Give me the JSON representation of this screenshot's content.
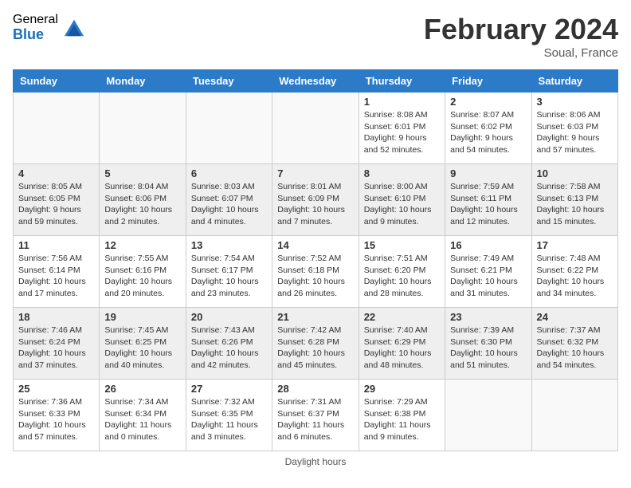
{
  "header": {
    "logo_general": "General",
    "logo_blue": "Blue",
    "month_title": "February 2024",
    "location": "Soual, France"
  },
  "weekdays": [
    "Sunday",
    "Monday",
    "Tuesday",
    "Wednesday",
    "Thursday",
    "Friday",
    "Saturday"
  ],
  "weeks": [
    [
      {
        "day": "",
        "info": ""
      },
      {
        "day": "",
        "info": ""
      },
      {
        "day": "",
        "info": ""
      },
      {
        "day": "",
        "info": ""
      },
      {
        "day": "1",
        "info": "Sunrise: 8:08 AM\nSunset: 6:01 PM\nDaylight: 9 hours and 52 minutes."
      },
      {
        "day": "2",
        "info": "Sunrise: 8:07 AM\nSunset: 6:02 PM\nDaylight: 9 hours and 54 minutes."
      },
      {
        "day": "3",
        "info": "Sunrise: 8:06 AM\nSunset: 6:03 PM\nDaylight: 9 hours and 57 minutes."
      }
    ],
    [
      {
        "day": "4",
        "info": "Sunrise: 8:05 AM\nSunset: 6:05 PM\nDaylight: 9 hours and 59 minutes."
      },
      {
        "day": "5",
        "info": "Sunrise: 8:04 AM\nSunset: 6:06 PM\nDaylight: 10 hours and 2 minutes."
      },
      {
        "day": "6",
        "info": "Sunrise: 8:03 AM\nSunset: 6:07 PM\nDaylight: 10 hours and 4 minutes."
      },
      {
        "day": "7",
        "info": "Sunrise: 8:01 AM\nSunset: 6:09 PM\nDaylight: 10 hours and 7 minutes."
      },
      {
        "day": "8",
        "info": "Sunrise: 8:00 AM\nSunset: 6:10 PM\nDaylight: 10 hours and 9 minutes."
      },
      {
        "day": "9",
        "info": "Sunrise: 7:59 AM\nSunset: 6:11 PM\nDaylight: 10 hours and 12 minutes."
      },
      {
        "day": "10",
        "info": "Sunrise: 7:58 AM\nSunset: 6:13 PM\nDaylight: 10 hours and 15 minutes."
      }
    ],
    [
      {
        "day": "11",
        "info": "Sunrise: 7:56 AM\nSunset: 6:14 PM\nDaylight: 10 hours and 17 minutes."
      },
      {
        "day": "12",
        "info": "Sunrise: 7:55 AM\nSunset: 6:16 PM\nDaylight: 10 hours and 20 minutes."
      },
      {
        "day": "13",
        "info": "Sunrise: 7:54 AM\nSunset: 6:17 PM\nDaylight: 10 hours and 23 minutes."
      },
      {
        "day": "14",
        "info": "Sunrise: 7:52 AM\nSunset: 6:18 PM\nDaylight: 10 hours and 26 minutes."
      },
      {
        "day": "15",
        "info": "Sunrise: 7:51 AM\nSunset: 6:20 PM\nDaylight: 10 hours and 28 minutes."
      },
      {
        "day": "16",
        "info": "Sunrise: 7:49 AM\nSunset: 6:21 PM\nDaylight: 10 hours and 31 minutes."
      },
      {
        "day": "17",
        "info": "Sunrise: 7:48 AM\nSunset: 6:22 PM\nDaylight: 10 hours and 34 minutes."
      }
    ],
    [
      {
        "day": "18",
        "info": "Sunrise: 7:46 AM\nSunset: 6:24 PM\nDaylight: 10 hours and 37 minutes."
      },
      {
        "day": "19",
        "info": "Sunrise: 7:45 AM\nSunset: 6:25 PM\nDaylight: 10 hours and 40 minutes."
      },
      {
        "day": "20",
        "info": "Sunrise: 7:43 AM\nSunset: 6:26 PM\nDaylight: 10 hours and 42 minutes."
      },
      {
        "day": "21",
        "info": "Sunrise: 7:42 AM\nSunset: 6:28 PM\nDaylight: 10 hours and 45 minutes."
      },
      {
        "day": "22",
        "info": "Sunrise: 7:40 AM\nSunset: 6:29 PM\nDaylight: 10 hours and 48 minutes."
      },
      {
        "day": "23",
        "info": "Sunrise: 7:39 AM\nSunset: 6:30 PM\nDaylight: 10 hours and 51 minutes."
      },
      {
        "day": "24",
        "info": "Sunrise: 7:37 AM\nSunset: 6:32 PM\nDaylight: 10 hours and 54 minutes."
      }
    ],
    [
      {
        "day": "25",
        "info": "Sunrise: 7:36 AM\nSunset: 6:33 PM\nDaylight: 10 hours and 57 minutes."
      },
      {
        "day": "26",
        "info": "Sunrise: 7:34 AM\nSunset: 6:34 PM\nDaylight: 11 hours and 0 minutes."
      },
      {
        "day": "27",
        "info": "Sunrise: 7:32 AM\nSunset: 6:35 PM\nDaylight: 11 hours and 3 minutes."
      },
      {
        "day": "28",
        "info": "Sunrise: 7:31 AM\nSunset: 6:37 PM\nDaylight: 11 hours and 6 minutes."
      },
      {
        "day": "29",
        "info": "Sunrise: 7:29 AM\nSunset: 6:38 PM\nDaylight: 11 hours and 9 minutes."
      },
      {
        "day": "",
        "info": ""
      },
      {
        "day": "",
        "info": ""
      }
    ]
  ],
  "footer": {
    "daylight_hours_label": "Daylight hours"
  }
}
